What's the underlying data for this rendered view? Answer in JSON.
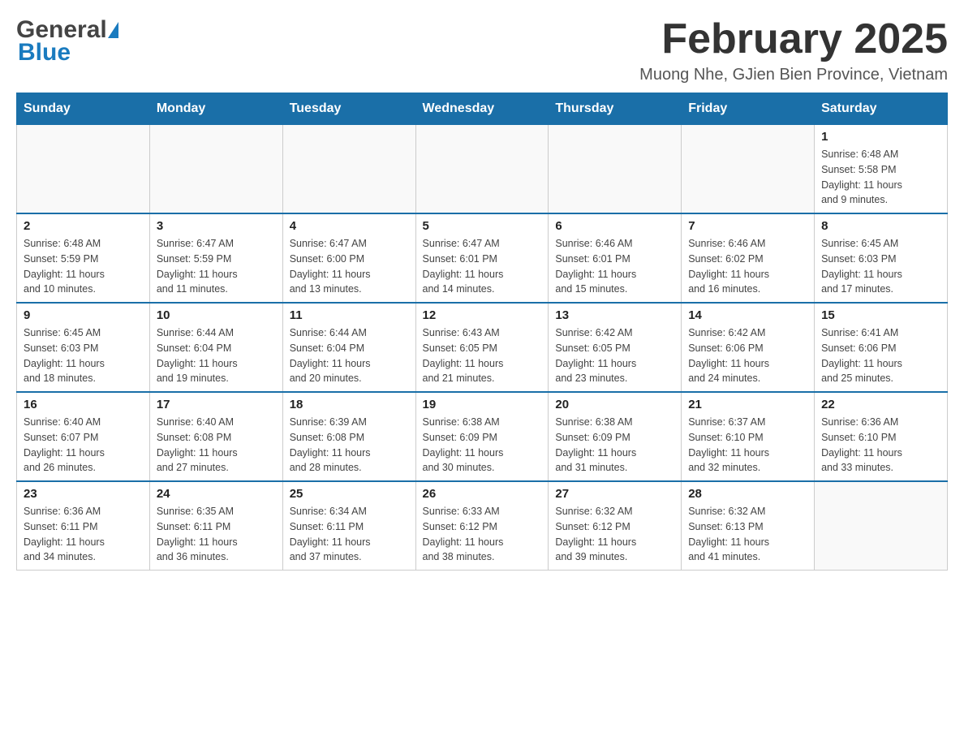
{
  "logo": {
    "general": "General",
    "blue": "Blue"
  },
  "title": "February 2025",
  "subtitle": "Muong Nhe, GJien Bien Province, Vietnam",
  "weekdays": [
    "Sunday",
    "Monday",
    "Tuesday",
    "Wednesday",
    "Thursday",
    "Friday",
    "Saturday"
  ],
  "weeks": [
    [
      {
        "day": "",
        "info": ""
      },
      {
        "day": "",
        "info": ""
      },
      {
        "day": "",
        "info": ""
      },
      {
        "day": "",
        "info": ""
      },
      {
        "day": "",
        "info": ""
      },
      {
        "day": "",
        "info": ""
      },
      {
        "day": "1",
        "info": "Sunrise: 6:48 AM\nSunset: 5:58 PM\nDaylight: 11 hours\nand 9 minutes."
      }
    ],
    [
      {
        "day": "2",
        "info": "Sunrise: 6:48 AM\nSunset: 5:59 PM\nDaylight: 11 hours\nand 10 minutes."
      },
      {
        "day": "3",
        "info": "Sunrise: 6:47 AM\nSunset: 5:59 PM\nDaylight: 11 hours\nand 11 minutes."
      },
      {
        "day": "4",
        "info": "Sunrise: 6:47 AM\nSunset: 6:00 PM\nDaylight: 11 hours\nand 13 minutes."
      },
      {
        "day": "5",
        "info": "Sunrise: 6:47 AM\nSunset: 6:01 PM\nDaylight: 11 hours\nand 14 minutes."
      },
      {
        "day": "6",
        "info": "Sunrise: 6:46 AM\nSunset: 6:01 PM\nDaylight: 11 hours\nand 15 minutes."
      },
      {
        "day": "7",
        "info": "Sunrise: 6:46 AM\nSunset: 6:02 PM\nDaylight: 11 hours\nand 16 minutes."
      },
      {
        "day": "8",
        "info": "Sunrise: 6:45 AM\nSunset: 6:03 PM\nDaylight: 11 hours\nand 17 minutes."
      }
    ],
    [
      {
        "day": "9",
        "info": "Sunrise: 6:45 AM\nSunset: 6:03 PM\nDaylight: 11 hours\nand 18 minutes."
      },
      {
        "day": "10",
        "info": "Sunrise: 6:44 AM\nSunset: 6:04 PM\nDaylight: 11 hours\nand 19 minutes."
      },
      {
        "day": "11",
        "info": "Sunrise: 6:44 AM\nSunset: 6:04 PM\nDaylight: 11 hours\nand 20 minutes."
      },
      {
        "day": "12",
        "info": "Sunrise: 6:43 AM\nSunset: 6:05 PM\nDaylight: 11 hours\nand 21 minutes."
      },
      {
        "day": "13",
        "info": "Sunrise: 6:42 AM\nSunset: 6:05 PM\nDaylight: 11 hours\nand 23 minutes."
      },
      {
        "day": "14",
        "info": "Sunrise: 6:42 AM\nSunset: 6:06 PM\nDaylight: 11 hours\nand 24 minutes."
      },
      {
        "day": "15",
        "info": "Sunrise: 6:41 AM\nSunset: 6:06 PM\nDaylight: 11 hours\nand 25 minutes."
      }
    ],
    [
      {
        "day": "16",
        "info": "Sunrise: 6:40 AM\nSunset: 6:07 PM\nDaylight: 11 hours\nand 26 minutes."
      },
      {
        "day": "17",
        "info": "Sunrise: 6:40 AM\nSunset: 6:08 PM\nDaylight: 11 hours\nand 27 minutes."
      },
      {
        "day": "18",
        "info": "Sunrise: 6:39 AM\nSunset: 6:08 PM\nDaylight: 11 hours\nand 28 minutes."
      },
      {
        "day": "19",
        "info": "Sunrise: 6:38 AM\nSunset: 6:09 PM\nDaylight: 11 hours\nand 30 minutes."
      },
      {
        "day": "20",
        "info": "Sunrise: 6:38 AM\nSunset: 6:09 PM\nDaylight: 11 hours\nand 31 minutes."
      },
      {
        "day": "21",
        "info": "Sunrise: 6:37 AM\nSunset: 6:10 PM\nDaylight: 11 hours\nand 32 minutes."
      },
      {
        "day": "22",
        "info": "Sunrise: 6:36 AM\nSunset: 6:10 PM\nDaylight: 11 hours\nand 33 minutes."
      }
    ],
    [
      {
        "day": "23",
        "info": "Sunrise: 6:36 AM\nSunset: 6:11 PM\nDaylight: 11 hours\nand 34 minutes."
      },
      {
        "day": "24",
        "info": "Sunrise: 6:35 AM\nSunset: 6:11 PM\nDaylight: 11 hours\nand 36 minutes."
      },
      {
        "day": "25",
        "info": "Sunrise: 6:34 AM\nSunset: 6:11 PM\nDaylight: 11 hours\nand 37 minutes."
      },
      {
        "day": "26",
        "info": "Sunrise: 6:33 AM\nSunset: 6:12 PM\nDaylight: 11 hours\nand 38 minutes."
      },
      {
        "day": "27",
        "info": "Sunrise: 6:32 AM\nSunset: 6:12 PM\nDaylight: 11 hours\nand 39 minutes."
      },
      {
        "day": "28",
        "info": "Sunrise: 6:32 AM\nSunset: 6:13 PM\nDaylight: 11 hours\nand 41 minutes."
      },
      {
        "day": "",
        "info": ""
      }
    ]
  ]
}
